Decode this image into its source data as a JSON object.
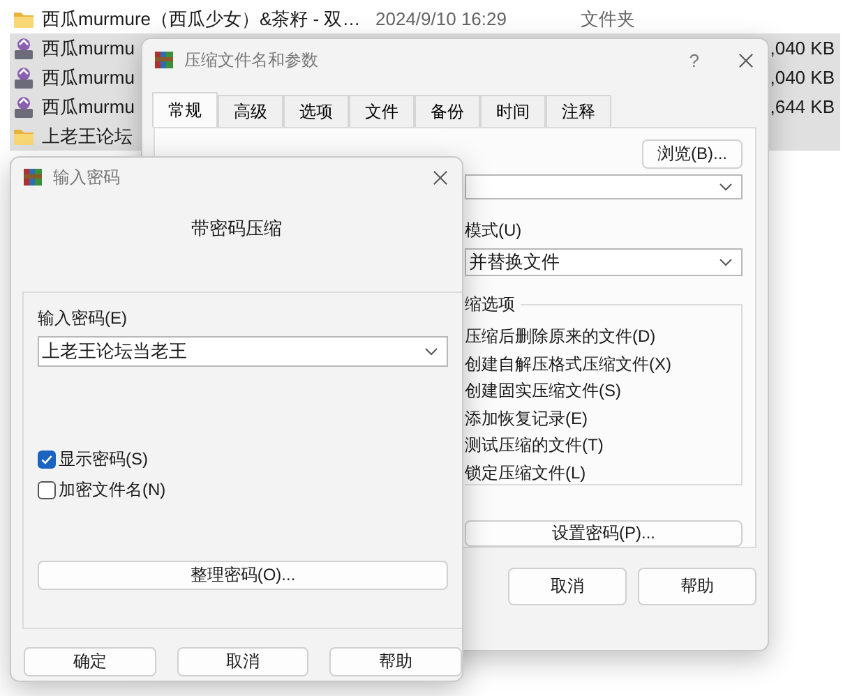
{
  "explorer": {
    "rows": [
      {
        "kind": "folder",
        "name": "西瓜murmure（西瓜少女）&茶籽 - 双…",
        "date": "2024/9/10 16:29",
        "type": "文件夹",
        "selected": false
      },
      {
        "kind": "archive",
        "name": "西瓜murmu",
        "size": ",040 KB",
        "selected": true
      },
      {
        "kind": "archive",
        "name": "西瓜murmu",
        "size": ",040 KB",
        "selected": true
      },
      {
        "kind": "archive",
        "name": "西瓜murmu",
        "size": ",644 KB",
        "selected": true
      },
      {
        "kind": "folder",
        "name": "上老王论坛",
        "selected": true
      }
    ]
  },
  "archive_dialog": {
    "title": "压缩文件名和参数",
    "help": "?",
    "tabs": [
      {
        "label": "常规",
        "selected": true
      },
      {
        "label": "高级",
        "selected": false
      },
      {
        "label": "选项",
        "selected": false
      },
      {
        "label": "文件",
        "selected": false
      },
      {
        "label": "备份",
        "selected": false
      },
      {
        "label": "时间",
        "selected": false
      },
      {
        "label": "注释",
        "selected": false
      }
    ],
    "browse_button": "浏览(B)...",
    "update_mode": {
      "label": "模式(U)",
      "value": "并替换文件"
    },
    "options": {
      "title": "缩选项",
      "items": [
        "压缩后删除原来的文件(D)",
        "创建自解压格式压缩文件(X)",
        "创建固实压缩文件(S)",
        "添加恢复记录(E)",
        "测试压缩的文件(T)",
        "锁定压缩文件(L)"
      ]
    },
    "set_password_button": "设置密码(P)...",
    "buttons": [
      "取消",
      "帮助"
    ]
  },
  "password_dialog": {
    "title": "输入密码",
    "heading": "带密码压缩",
    "password": {
      "label": "输入密码(E)",
      "value": "上老王论坛当老王"
    },
    "checkboxes": [
      {
        "label": "显示密码(S)",
        "checked": true
      },
      {
        "label": "加密文件名(N)",
        "checked": false
      }
    ],
    "organize_button": "整理密码(O)...",
    "buttons": [
      "确定",
      "取消",
      "帮助"
    ]
  }
}
